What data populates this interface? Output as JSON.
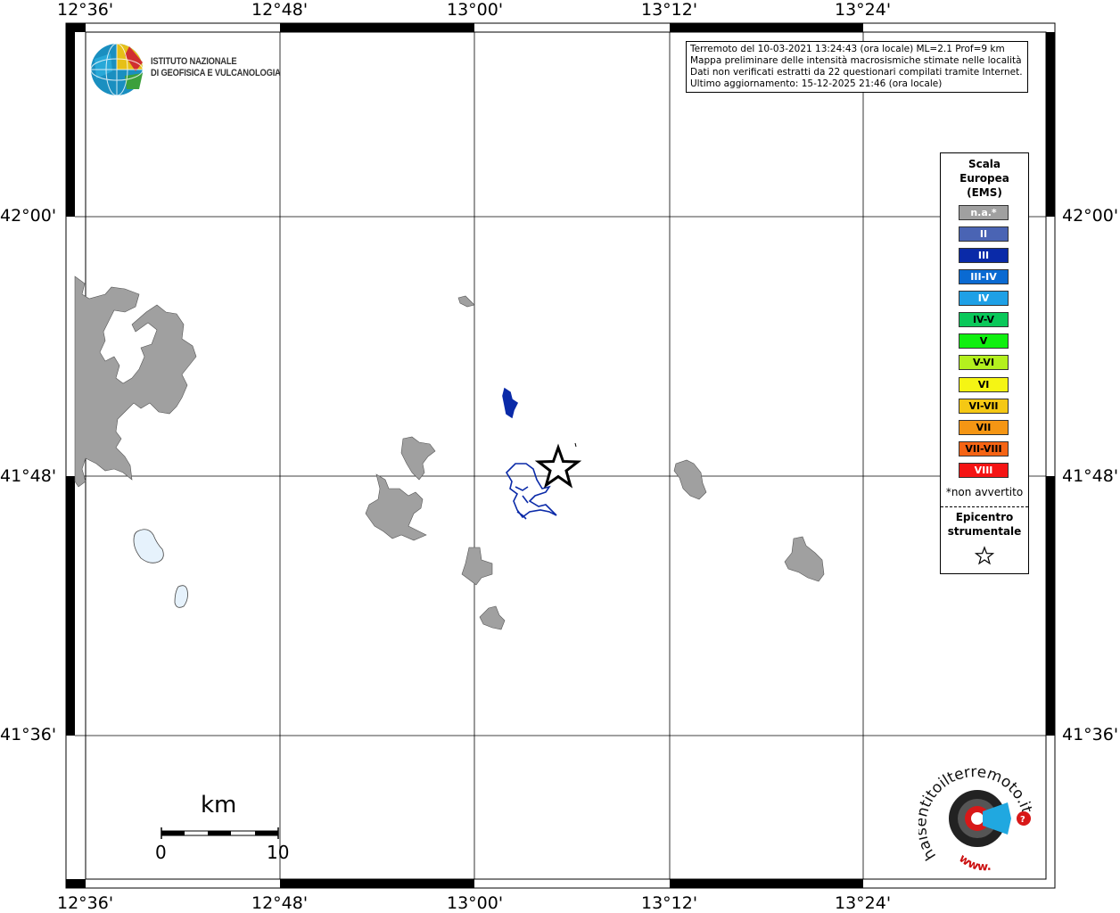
{
  "frame": {
    "lon_labels": [
      "12°36'",
      "12°48'",
      "13°00'",
      "13°12'",
      "13°24'"
    ],
    "lat_labels": [
      "42°00'",
      "41°48'",
      "41°36'"
    ]
  },
  "info_box": {
    "line1": "Terremoto del 10-03-2021 13:24:43 (ora locale) ML=2.1 Prof=9 km",
    "line2": "Mappa preliminare delle intensità macrosismiche stimate nelle località",
    "line3": "Dati non verificati estratti da 22 questionari compilati tramite Internet.",
    "line4": "Ultimo aggiornamento: 15-12-2025 21:46 (ora locale)"
  },
  "institute_logo": {
    "line1": "ISTITUTO NAZIONALE",
    "line2": "DI GEOFISICA E VULCANOLOGIA"
  },
  "legend": {
    "title_line1": "Scala",
    "title_line2": "Europea",
    "title_line3": "(EMS)",
    "classes": [
      {
        "label": "n.a.*",
        "color": "#a0a0a0"
      },
      {
        "label": "II",
        "color": "#4a64b4"
      },
      {
        "label": "III",
        "color": "#0a2aa8"
      },
      {
        "label": "III-IV",
        "color": "#0a6ad2"
      },
      {
        "label": "IV",
        "color": "#1ea0e6"
      },
      {
        "label": "IV-V",
        "color": "#0ac85a"
      },
      {
        "label": "V",
        "color": "#10f010"
      },
      {
        "label": "V-VI",
        "color": "#b4f01e"
      },
      {
        "label": "VI",
        "color": "#f5f514"
      },
      {
        "label": "VI-VII",
        "color": "#f5c814"
      },
      {
        "label": "VII",
        "color": "#f59614"
      },
      {
        "label": "VII-VIII",
        "color": "#f56414"
      },
      {
        "label": "VIII",
        "color": "#f51414"
      }
    ],
    "na_note": "*non avvertito",
    "epicenter_line1": "Epicentro",
    "epicenter_line2": "strumentale"
  },
  "scale_bar": {
    "unit": "km",
    "start": "0",
    "end": "10"
  },
  "hsi_logo": {
    "text": "haisentitoilterremoto.it",
    "prefix": "www."
  },
  "colors": {
    "land_gray": "#a0a0a0",
    "lake_fill": "#e6f2fc",
    "intensity_III": "#0a2aa8"
  }
}
